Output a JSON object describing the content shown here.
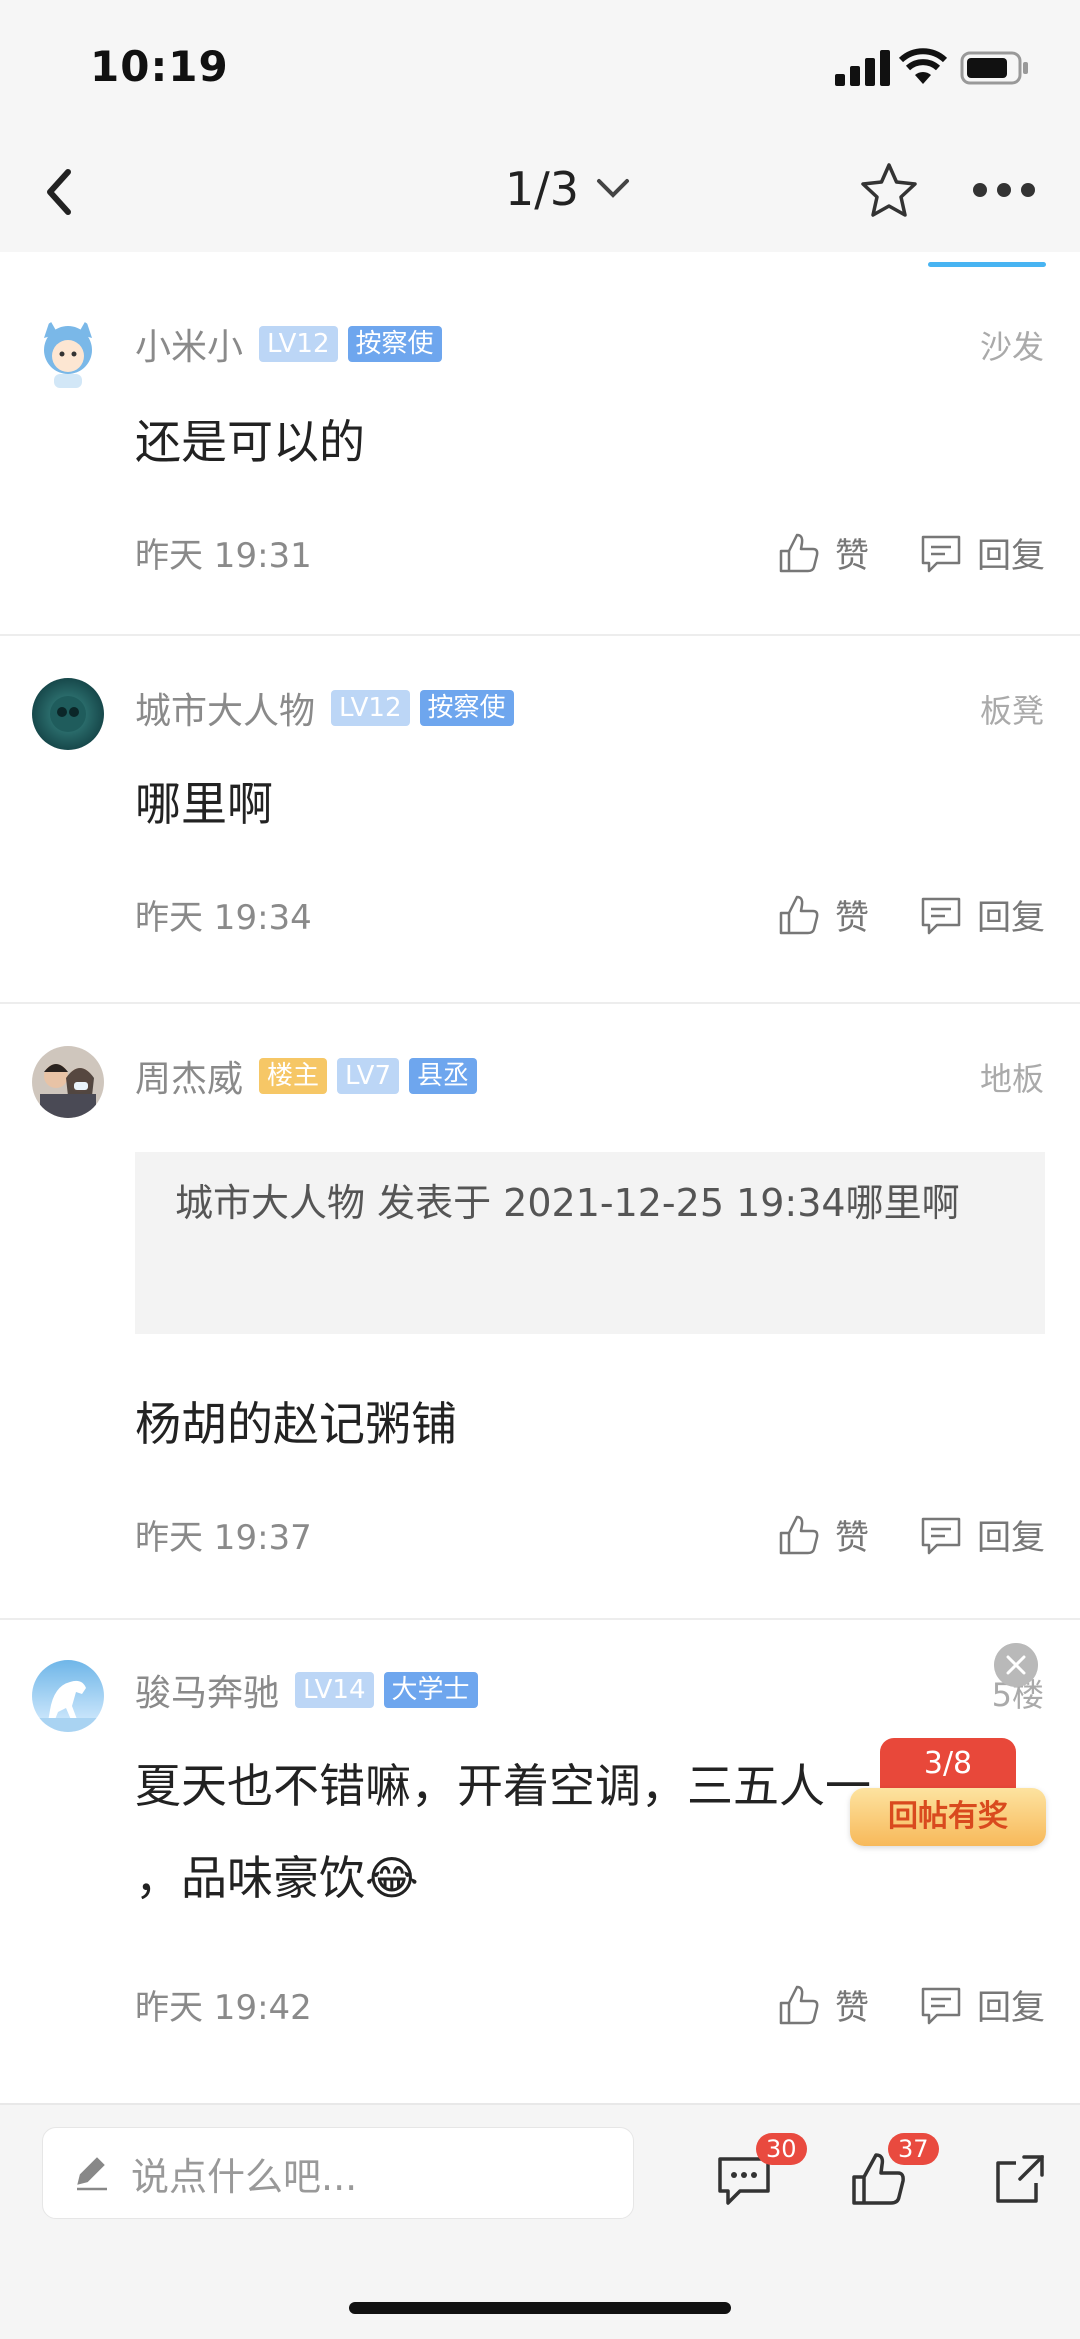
{
  "status": {
    "time": "10:19"
  },
  "header": {
    "page_indicator": "1/3"
  },
  "posts": [
    {
      "username": "小米小",
      "badges": [
        "LV12",
        "按察使"
      ],
      "floor": "沙发",
      "content": "还是可以的",
      "time": "昨天 19:31"
    },
    {
      "username": "城市大人物",
      "badges": [
        "LV12",
        "按察使"
      ],
      "floor": "板凳",
      "content": "哪里啊",
      "time": "昨天 19:34"
    },
    {
      "username": "周杰威",
      "badges": [
        "楼主",
        "LV7",
        "县丞"
      ],
      "floor": "地板",
      "quote": "城市大人物 发表于 2021-12-25 19:34哪里啊",
      "content": "杨胡的赵记粥铺",
      "time": "昨天 19:37"
    },
    {
      "username": "骏马奔驰",
      "badges": [
        "LV14",
        "大学士"
      ],
      "floor": "5楼",
      "content_line1": "夏天也不错嘛，开着空调，三五人一",
      "content_line2": "，品味豪饮😂",
      "time": "昨天 19:42"
    }
  ],
  "actions": {
    "like_label": "赞",
    "reply_label": "回复"
  },
  "reward_float": {
    "progress": "3/8",
    "label": "回帖有奖"
  },
  "bottom_bar": {
    "input_placeholder": "说点什么吧...",
    "comment_count": "30",
    "like_count": "37"
  },
  "colors": {
    "accent_blue": "#48b4f2",
    "badge_red": "#e94a3f",
    "owner_badge": "#f6c766",
    "title_badge": "#6ea6ee"
  }
}
